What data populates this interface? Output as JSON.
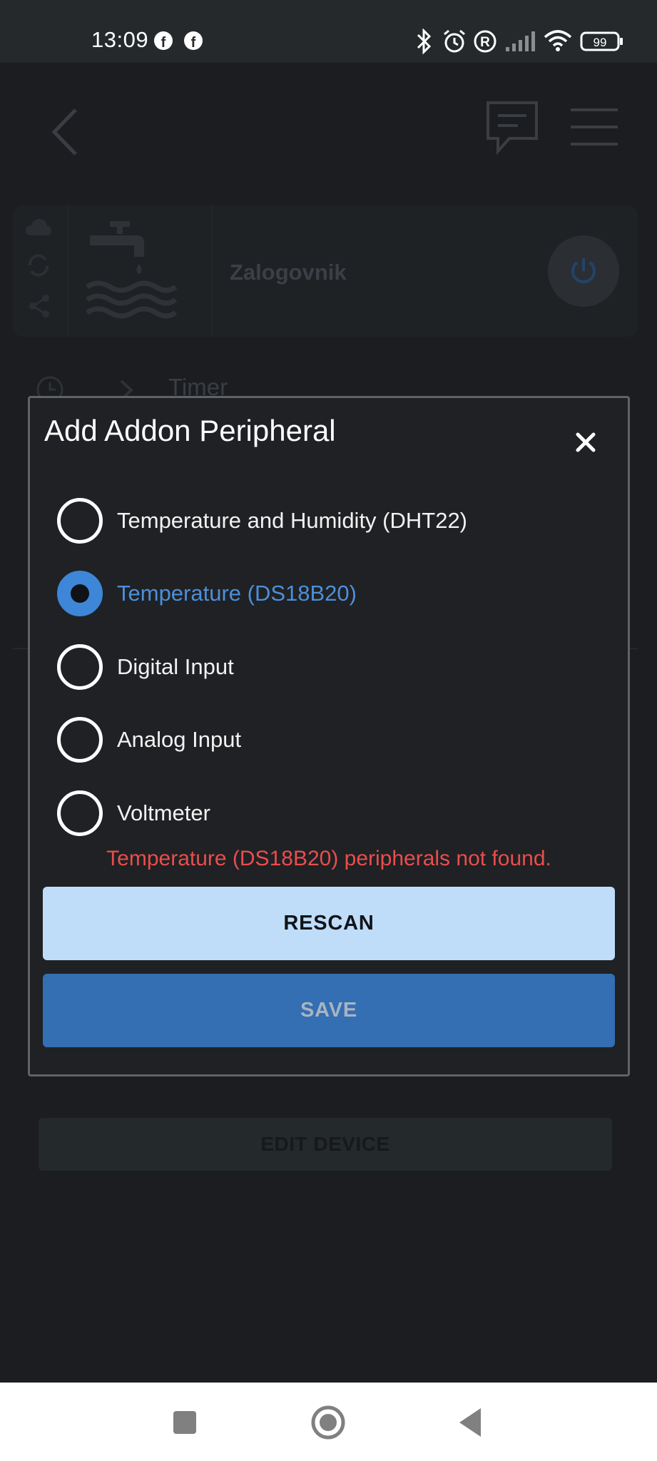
{
  "status_bar": {
    "time": "13:09",
    "notification_icons": [
      "facebook-icon",
      "facebook-icon"
    ],
    "system_icons": [
      "bluetooth-icon",
      "alarm-icon",
      "registered-icon",
      "signal-icon",
      "wifi-icon",
      "battery-icon"
    ],
    "battery_level": "99"
  },
  "header": {
    "icons": [
      "back-icon",
      "chat-icon",
      "menu-icon"
    ]
  },
  "device": {
    "name": "Zalogovnik",
    "image_icon": "water-tap-icon",
    "side_icons": [
      "cloud-icon",
      "sync-icon",
      "share-icon"
    ]
  },
  "background_sections": {
    "timer_label": "Timer",
    "edit_device_label": "EDIT DEVICE"
  },
  "dialog": {
    "title": "Add Addon Peripheral",
    "options": [
      {
        "label": "Temperature and Humidity (DHT22)",
        "selected": false
      },
      {
        "label": "Temperature (DS18B20)",
        "selected": true
      },
      {
        "label": "Digital Input",
        "selected": false
      },
      {
        "label": "Analog Input",
        "selected": false
      },
      {
        "label": "Voltmeter",
        "selected": false
      }
    ],
    "error_message": "Temperature (DS18B20) peripherals not found.",
    "rescan_label": "RESCAN",
    "save_label": "SAVE"
  },
  "colors": {
    "accent": "#3d86d8",
    "error": "#ea4d4d",
    "rescan_bg": "#bfddf9",
    "save_bg": "#346eb3"
  },
  "nav_bar": {
    "buttons": [
      "recents-button",
      "home-button",
      "back-button"
    ]
  }
}
